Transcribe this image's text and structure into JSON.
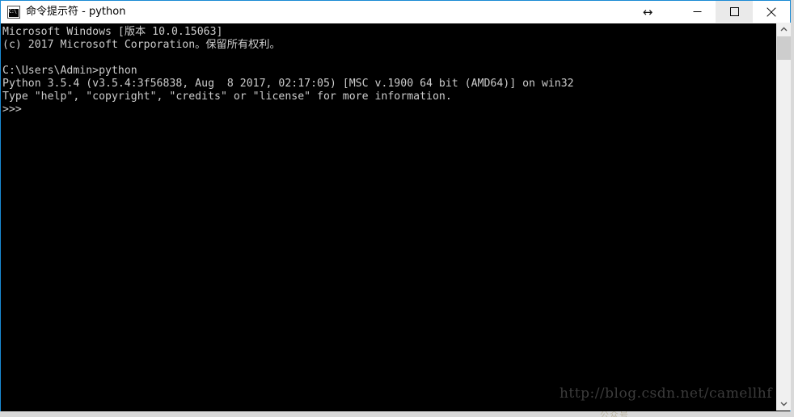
{
  "window": {
    "title": "命令提示符 - python",
    "icon": "console-icon",
    "icon_text": "C:\\",
    "accent_border": "#1a8ad4",
    "titlebar_bg": "#ffffff",
    "controls": {
      "resize_cursor_glyph": "↔",
      "minimize_label": "最小化",
      "maximize_label": "最大化",
      "close_label": "关闭"
    }
  },
  "terminal": {
    "background": "#000000",
    "foreground": "#cccccc",
    "lines": [
      "Microsoft Windows [版本 10.0.15063]",
      "(c) 2017 Microsoft Corporation。保留所有权利。",
      "",
      "C:\\Users\\Admin>python",
      "Python 3.5.4 (v3.5.4:3f56838, Aug  8 2017, 02:17:05) [MSC v.1900 64 bit (AMD64)] on win32",
      "Type \"help\", \"copyright\", \"credits\" or \"license\" for more information.",
      ">>>"
    ],
    "prompt": ">>>",
    "watermark": "http://blog.csdn.net/camellhf"
  },
  "scrollbar": {
    "up_arrow": "⌃",
    "down_arrow": "⌄",
    "thumb_position_percent": 0
  },
  "desktop": {
    "background": "#d9d9d9",
    "artifact_text": "公众号"
  }
}
